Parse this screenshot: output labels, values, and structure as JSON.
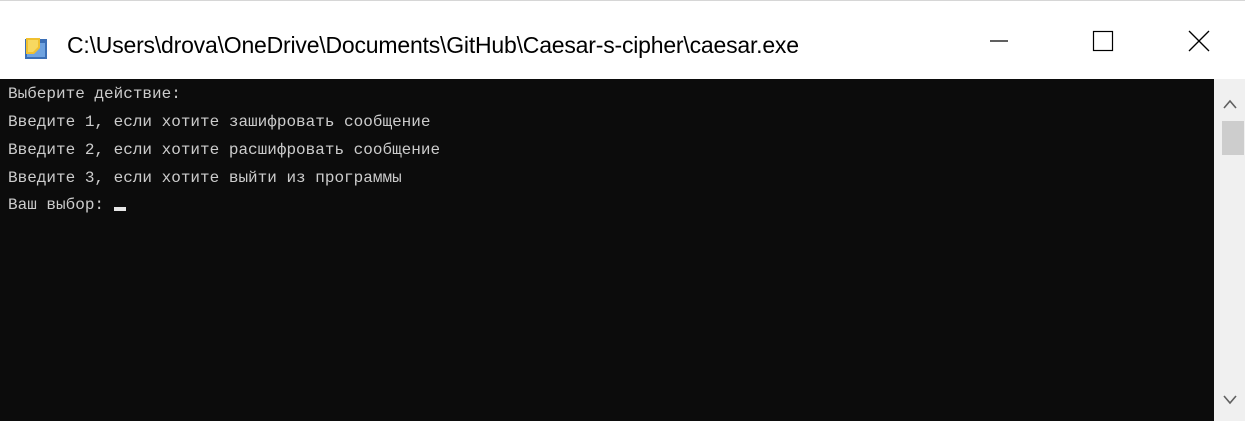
{
  "window": {
    "title": "C:\\Users\\drova\\OneDrive\\Documents\\GitHub\\Caesar-s-cipher\\caesar.exe",
    "app_icon": "console-app-icon",
    "controls": {
      "minimize_icon": "minimize-icon",
      "maximize_icon": "maximize-icon",
      "close_icon": "close-icon"
    }
  },
  "console": {
    "background": "#0c0c0c",
    "text_color": "#cccccc",
    "lines": [
      "Выберите действие:",
      "Введите 1, если хотите зашифровать сообщение",
      "Введите 2, если хотите расшифровать сообщение",
      "Введите 3, если хотите выйти из программы",
      "Ваш выбор:"
    ]
  },
  "scrollbar": {
    "up_icon": "scroll-up-arrow-icon",
    "down_icon": "scroll-down-arrow-icon"
  }
}
